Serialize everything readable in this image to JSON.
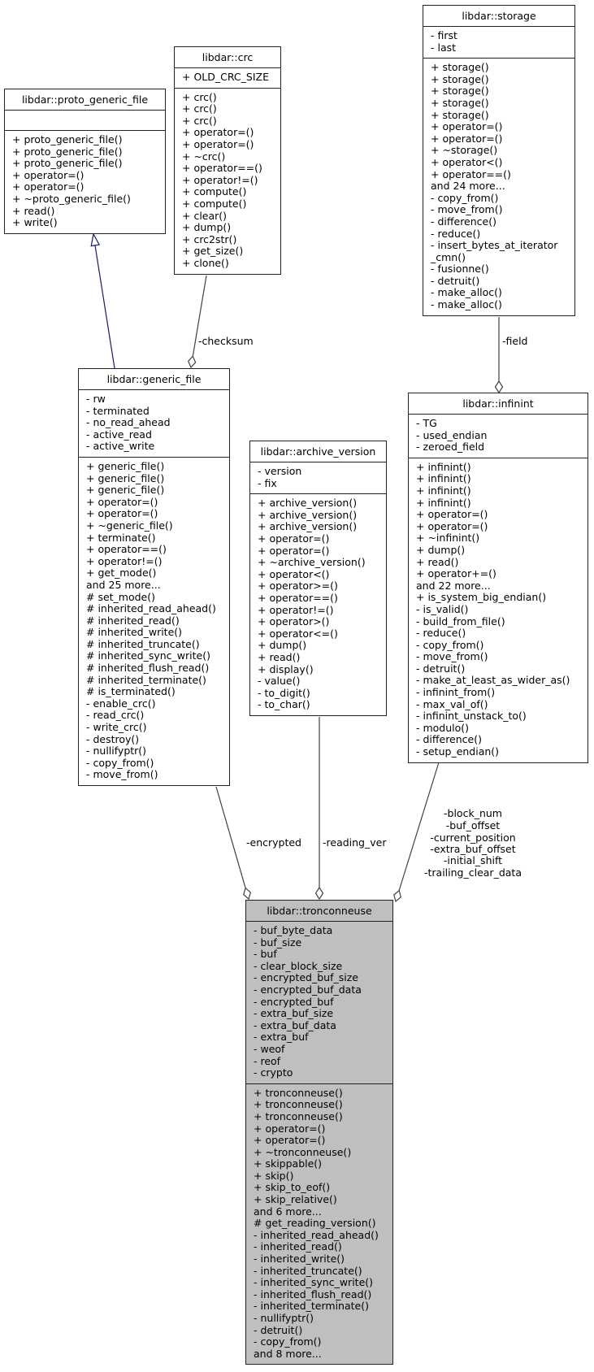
{
  "classes": {
    "proto": {
      "name": "libdar::proto_generic_file",
      "attrs": [],
      "methods": [
        "+ proto_generic_file()",
        "+ proto_generic_file()",
        "+ proto_generic_file()",
        "+ operator=()",
        "+ operator=()",
        "+ ~proto_generic_file()",
        "+ read()",
        "+ write()"
      ]
    },
    "crc": {
      "name": "libdar::crc",
      "attrs": [
        "+ OLD_CRC_SIZE"
      ],
      "methods": [
        "+ crc()",
        "+ crc()",
        "+ crc()",
        "+ operator=()",
        "+ operator=()",
        "+ ~crc()",
        "+ operator==()",
        "+ operator!=()",
        "+ compute()",
        "+ compute()",
        "+ clear()",
        "+ dump()",
        "+ crc2str()",
        "+ get_size()",
        "+ clone()"
      ]
    },
    "storage": {
      "name": "libdar::storage",
      "attrs": [
        "- first",
        "- last"
      ],
      "methods": [
        "+ storage()",
        "+ storage()",
        "+ storage()",
        "+ storage()",
        "+ storage()",
        "+ operator=()",
        "+ operator=()",
        "+ ~storage()",
        "+ operator<()",
        "+ operator==()",
        "and 24 more...",
        "- copy_from()",
        "- move_from()",
        "- difference()",
        "- reduce()",
        "- insert_bytes_at_iterator",
        "_cmn()",
        "- fusionne()",
        "- detruit()",
        "- make_alloc()",
        "- make_alloc()"
      ]
    },
    "generic": {
      "name": "libdar::generic_file",
      "attrs": [
        "- rw",
        "- terminated",
        "- no_read_ahead",
        "- active_read",
        "- active_write"
      ],
      "methods": [
        "+ generic_file()",
        "+ generic_file()",
        "+ generic_file()",
        "+ operator=()",
        "+ operator=()",
        "+ ~generic_file()",
        "+ terminate()",
        "+ operator==()",
        "+ operator!=()",
        "+ get_mode()",
        "and 25 more...",
        "# set_mode()",
        "# inherited_read_ahead()",
        "# inherited_read()",
        "# inherited_write()",
        "# inherited_truncate()",
        "# inherited_sync_write()",
        "# inherited_flush_read()",
        "# inherited_terminate()",
        "# is_terminated()",
        "- enable_crc()",
        "- read_crc()",
        "- write_crc()",
        "- destroy()",
        "- nullifyptr()",
        "- copy_from()",
        "- move_from()"
      ]
    },
    "archive": {
      "name": "libdar::archive_version",
      "attrs": [
        "- version",
        "- fix"
      ],
      "methods": [
        "+ archive_version()",
        "+ archive_version()",
        "+ archive_version()",
        "+ operator=()",
        "+ operator=()",
        "+ ~archive_version()",
        "+ operator<()",
        "+ operator>=()",
        "+ operator==()",
        "+ operator!=()",
        "+ operator>()",
        "+ operator<=()",
        "+ dump()",
        "+ read()",
        "+ display()",
        "- value()",
        "- to_digit()",
        "- to_char()"
      ]
    },
    "infinint": {
      "name": "libdar::infinint",
      "attrs": [
        "- TG",
        "- used_endian",
        "- zeroed_field"
      ],
      "methods": [
        "+ infinint()",
        "+ infinint()",
        "+ infinint()",
        "+ infinint()",
        "+ operator=()",
        "+ operator=()",
        "+ ~infinint()",
        "+ dump()",
        "+ read()",
        "+ operator+=()",
        "and 22 more...",
        "+ is_system_big_endian()",
        "- is_valid()",
        "- build_from_file()",
        "- reduce()",
        "- copy_from()",
        "- move_from()",
        "- detruit()",
        "- make_at_least_as_wider_as()",
        "- infinint_from()",
        "- max_val_of()",
        "- infinint_unstack_to()",
        "- modulo()",
        "- difference()",
        "- setup_endian()"
      ]
    },
    "tronc": {
      "name": "libdar::tronconneuse",
      "highlighted": true,
      "attrs": [
        "- buf_byte_data",
        "- buf_size",
        "- buf",
        "- clear_block_size",
        "- encrypted_buf_size",
        "- encrypted_buf_data",
        "- encrypted_buf",
        "- extra_buf_size",
        "- extra_buf_data",
        "- extra_buf",
        "- weof",
        "- reof",
        "- crypto"
      ],
      "methods": [
        "+ tronconneuse()",
        "+ tronconneuse()",
        "+ tronconneuse()",
        "+ operator=()",
        "+ operator=()",
        "+ ~tronconneuse()",
        "+ skippable()",
        "+ skip()",
        "+ skip_to_eof()",
        "+ skip_relative()",
        "and 6 more...",
        "# get_reading_version()",
        "- inherited_read_ahead()",
        "- inherited_read()",
        "- inherited_write()",
        "- inherited_truncate()",
        "- inherited_sync_write()",
        "- inherited_flush_read()",
        "- inherited_terminate()",
        "- nullifyptr()",
        "- detruit()",
        "- copy_from()",
        "and 8 more..."
      ]
    }
  },
  "edges": {
    "checksum": "-checksum",
    "field": "-field",
    "encrypted": "-encrypted",
    "reading_ver": "-reading_ver",
    "infinint_members": [
      "-block_num",
      "-buf_offset",
      "-current_position",
      "-extra_buf_offset",
      "-initial_shift",
      "-trailing_clear_data"
    ]
  },
  "colors": {
    "inheritance": "#191970",
    "aggregation": "#404040",
    "highlight_fill": "#bfbfbf"
  }
}
